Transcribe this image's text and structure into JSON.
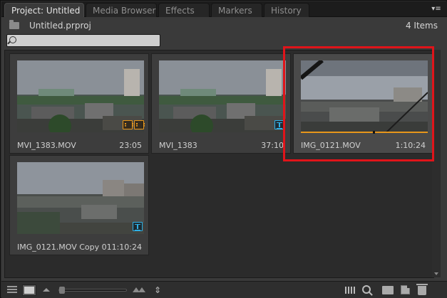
{
  "tabs": [
    {
      "label": "Project: Untitled",
      "active": true
    },
    {
      "label": "Media Browser",
      "active": false
    },
    {
      "label": "Effects",
      "active": false
    },
    {
      "label": "Markers",
      "active": false
    },
    {
      "label": "History",
      "active": false
    }
  ],
  "tab_close_glyph": "×",
  "panel_menu_glyph": "▾≡",
  "project": {
    "file_name": "Untitled.prproj",
    "item_count": "4 Items"
  },
  "search": {
    "value": "",
    "placeholder": ""
  },
  "items": [
    {
      "name": "MVI_1383.MOV",
      "duration": "23:05",
      "badge": "audio-video-icon",
      "selected": false
    },
    {
      "name": "MVI_1383",
      "duration": "37:10",
      "badge": "sequence-icon",
      "selected": false
    },
    {
      "name": "IMG_0121.MOV",
      "duration": "1:10:24",
      "badge": "",
      "selected": true,
      "scrub_position": 0.57
    },
    {
      "name": "IMG_0121.MOV Copy 01",
      "duration": "1:10:24",
      "badge": "sequence-icon",
      "selected": false
    }
  ],
  "colors": {
    "highlight_box": "#e0141a",
    "accent_orange": "#e8961b",
    "accent_blue": "#2fb0e6"
  },
  "toolbar": {
    "sort_glyph": "⇕"
  }
}
